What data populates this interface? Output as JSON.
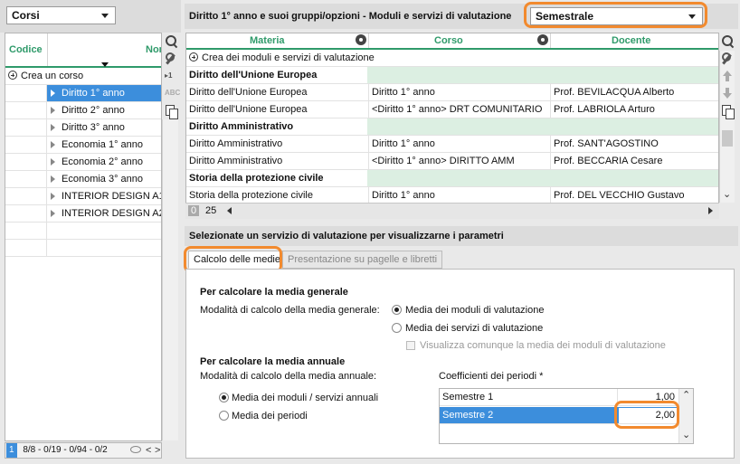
{
  "left": {
    "selector_value": "Corsi",
    "columns": {
      "code": "Codice",
      "name": "Nom"
    },
    "create_label": "Crea un corso",
    "items": [
      {
        "name": "Diritto 1° anno",
        "selected": true
      },
      {
        "name": "Diritto 2° anno",
        "selected": false
      },
      {
        "name": "Diritto 3° anno",
        "selected": false
      },
      {
        "name": "Economia 1° anno",
        "selected": false
      },
      {
        "name": "Economia 2° anno",
        "selected": false
      },
      {
        "name": "Economia 3° anno",
        "selected": false
      },
      {
        "name": "INTERIOR DESIGN A1",
        "selected": false
      },
      {
        "name": "INTERIOR DESIGN A2",
        "selected": false
      }
    ],
    "footer": {
      "page": "1",
      "counts": "8/8 - 0/19 - 0/94 - 0/2"
    },
    "tool_small": {
      "first": "▸1",
      "second": "ABC"
    }
  },
  "header": {
    "title": "Diritto 1° anno e suoi gruppi/opzioni - Moduli e servizi di valutazione",
    "period_value": "Semestrale"
  },
  "grid": {
    "columns": {
      "materia": "Materia",
      "corso": "Corso",
      "docente": "Docente"
    },
    "create_label": "Crea dei moduli e servizi di valutazione",
    "rows": [
      {
        "group": "Diritto dell'Unione Europea"
      },
      {
        "materia": "Diritto dell'Unione Europea",
        "corso": "Diritto 1° anno",
        "docente": "Prof. BEVILACQUA Alberto"
      },
      {
        "materia": "Diritto dell'Unione Europea",
        "corso": "<Diritto 1° anno> DRT COMUNITARIO",
        "docente": "Prof. LABRIOLA Arturo"
      },
      {
        "group": "Diritto Amministrativo"
      },
      {
        "materia": "Diritto Amministrativo",
        "corso": "Diritto 1° anno",
        "docente": "Prof. SANT'AGOSTINO"
      },
      {
        "materia": "Diritto Amministrativo",
        "corso": "<Diritto 1° anno> DIRITTO AMM",
        "docente": "Prof. BECCARIA Cesare"
      },
      {
        "group": "Storia della protezione civile"
      },
      {
        "materia": "Storia della protezione civile",
        "corso": "Diritto 1° anno",
        "docente": "Prof. DEL VECCHIO Gustavo"
      }
    ],
    "footer": {
      "a": "0",
      "b": "25"
    }
  },
  "details": {
    "title": "Selezionate un servizio di valutazione per visualizzarne i parametri",
    "tabs": [
      {
        "label": "Calcolo delle medie",
        "active": true
      },
      {
        "label": "Presentazione su pagelle e libretti",
        "active": false
      }
    ],
    "general": {
      "heading": "Per calcolare la media generale",
      "label": "Modalità di calcolo della media generale:",
      "options": [
        {
          "label": "Media dei moduli di valutazione",
          "checked": true
        },
        {
          "label": "Media dei servizi di valutazione",
          "checked": false
        }
      ],
      "checkbox_label": "Visualizza comunque la media dei moduli di valutazione"
    },
    "annual": {
      "heading": "Per calcolare la media annuale",
      "label": "Modalità di calcolo della media annuale:",
      "options": [
        {
          "label": "Media dei moduli / servizi annuali",
          "checked": true
        },
        {
          "label": "Media dei periodi",
          "checked": false
        }
      ],
      "coeff_heading": "Coefficienti dei periodi *",
      "periods": [
        {
          "name": "Semestre 1",
          "value": "1,00",
          "selected": false
        },
        {
          "name": "Semestre 2",
          "value": "2,00",
          "selected": true
        }
      ]
    }
  },
  "colors": {
    "accent_green": "#2f9a6a",
    "selection_blue": "#3c8edc",
    "highlight_orange": "#f28a2e"
  }
}
